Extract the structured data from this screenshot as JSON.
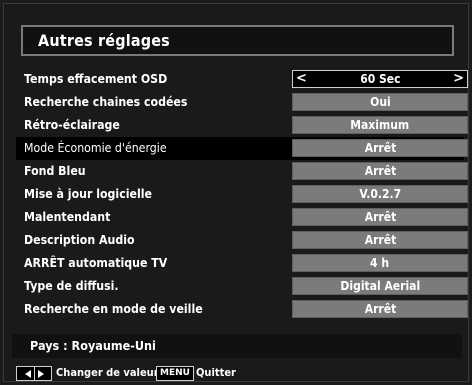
{
  "menu": {
    "title": "Autres réglages",
    "rows": [
      {
        "label": "Temps effacement OSD",
        "value": "60 Sec",
        "active": true
      },
      {
        "label": "Recherche chaines codées",
        "value": "Oui"
      },
      {
        "label": "Rétro-éclairage",
        "value": "Maximum"
      },
      {
        "label": "Mode Économie d'énergie",
        "value": "Arrêt",
        "selected": true
      },
      {
        "label": "Fond Bleu",
        "value": "Arrêt"
      },
      {
        "label": "Mise à jour logicielle",
        "value": "V.0.2.7"
      },
      {
        "label": "Malentendant",
        "value": "Arrêt"
      },
      {
        "label": "Description Audio",
        "value": "Arrêt"
      },
      {
        "label": "ARRÊT automatique TV",
        "value": "4 h"
      },
      {
        "label": "Type de diffusi.",
        "value": "Digital Aerial"
      },
      {
        "label": "Recherche en mode de veille",
        "value": "Arrêt"
      }
    ],
    "arrow_left": "<",
    "arrow_right": ">"
  },
  "info": {
    "pays": "Pays : Royaume-Uni"
  },
  "footer": {
    "change_value": "Changer de valeur",
    "menu_key": "MENU",
    "quit": "Quitter"
  }
}
